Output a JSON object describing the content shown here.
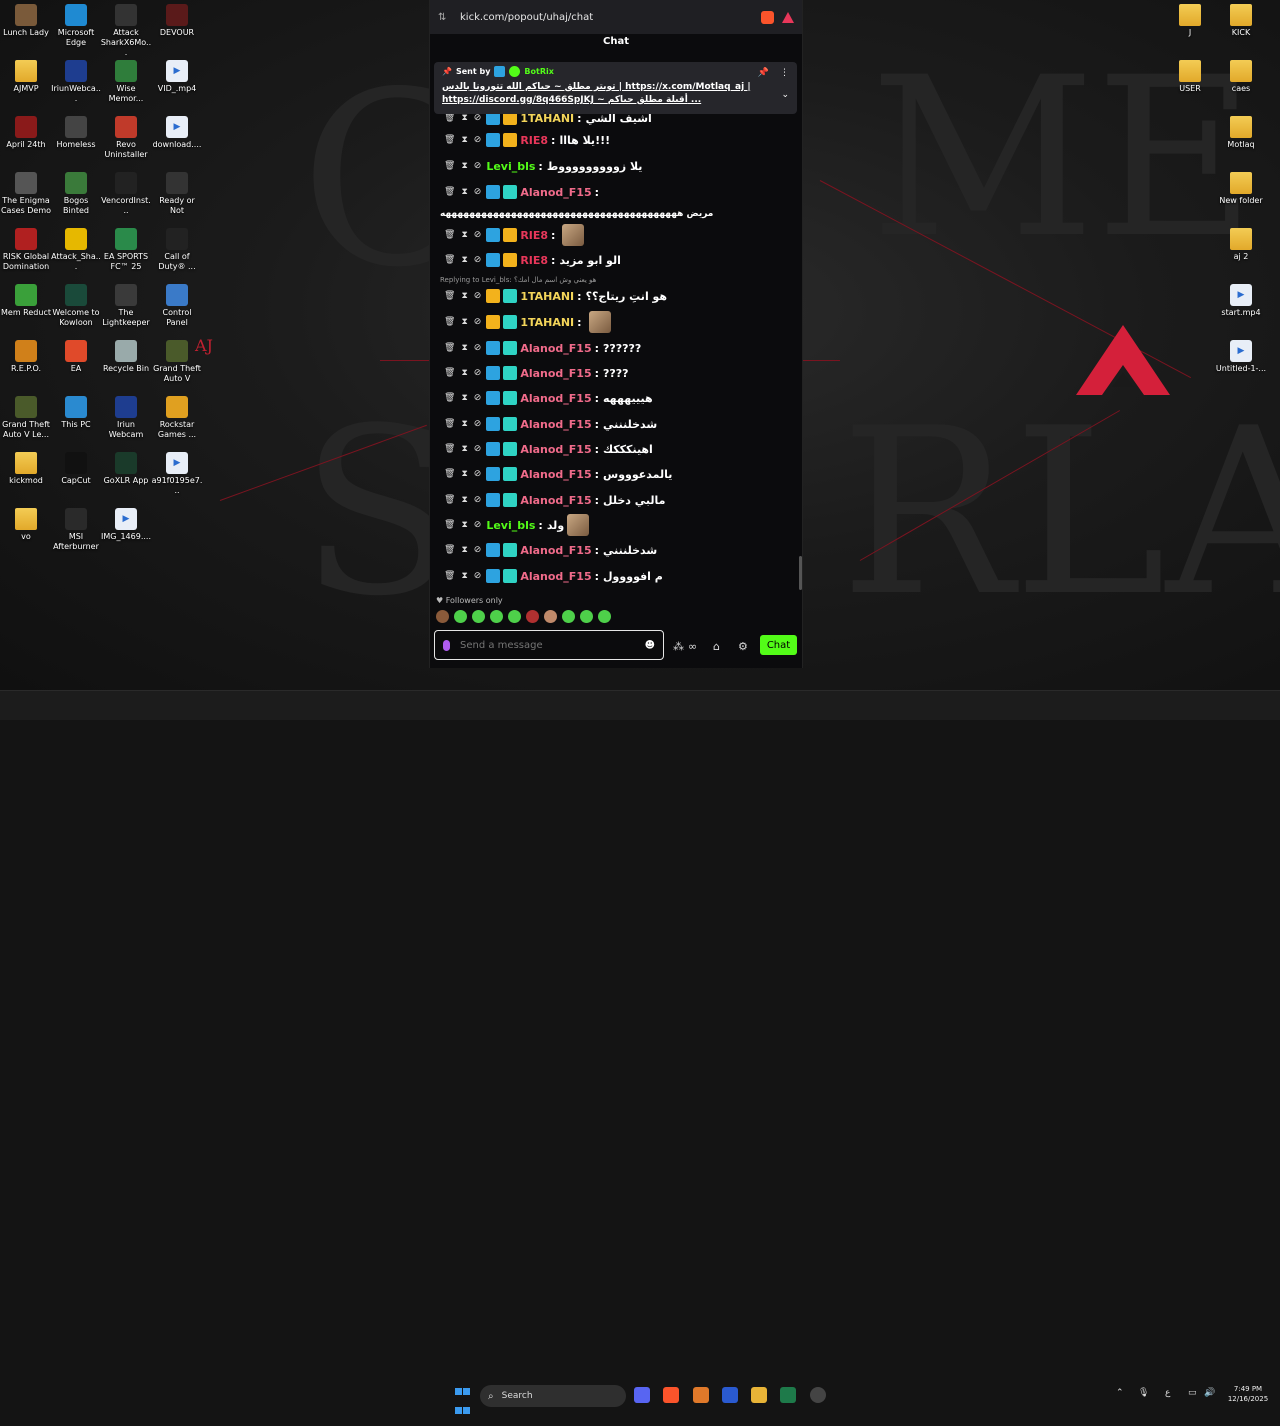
{
  "desktop": {
    "left_icons": [
      {
        "label": "Lunch Lady",
        "color": "#7a5a3a"
      },
      {
        "label": "Microsoft Edge",
        "color": "#1f8ad2"
      },
      {
        "label": "Attack SharkX6Mo...",
        "color": "#333"
      },
      {
        "label": "DEVOUR",
        "color": "#5a1a1a"
      },
      {
        "label": "AJMVP",
        "color": "folder"
      },
      {
        "label": "IriunWebca...",
        "color": "#1e3d8f"
      },
      {
        "label": "Wise Memor...",
        "color": "#2f7d3b"
      },
      {
        "label": "VID_.mp4",
        "color": "file"
      },
      {
        "label": "April 24th",
        "color": "#8a1a1a"
      },
      {
        "label": "Homeless",
        "color": "#444"
      },
      {
        "label": "Revo Uninstaller",
        "color": "#c03a2a"
      },
      {
        "label": "download....",
        "color": "file"
      },
      {
        "label": "The Enigma Cases Demo",
        "color": "#555"
      },
      {
        "label": "Bogos Binted",
        "color": "#3a7a3a"
      },
      {
        "label": "VencordInst...",
        "color": "#222"
      },
      {
        "label": "Ready or Not",
        "color": "#333"
      },
      {
        "label": "RISK Global Domination",
        "color": "#b02020"
      },
      {
        "label": "Attack_Sha...",
        "color": "#e6b800"
      },
      {
        "label": "EA SPORTS FC™ 25",
        "color": "#2a8a4a"
      },
      {
        "label": "Call of Duty® ...",
        "color": "#222"
      },
      {
        "label": "Mem Reduct",
        "color": "#3aa03a"
      },
      {
        "label": "Welcome to Kowloon",
        "color": "#1a4a3a"
      },
      {
        "label": "The Lightkeeper",
        "color": "#3a3a3a"
      },
      {
        "label": "Control Panel",
        "color": "#3a7ac8"
      },
      {
        "label": "R.E.P.O.",
        "color": "#d0801a"
      },
      {
        "label": "EA",
        "color": "#e04a2a"
      },
      {
        "label": "Recycle Bin",
        "color": "#9aa"
      },
      {
        "label": "Grand Theft Auto V",
        "color": "#4a5a2a"
      },
      {
        "label": "Grand Theft Auto V Le...",
        "color": "#4a5a2a"
      },
      {
        "label": "This PC",
        "color": "#2a8ad0"
      },
      {
        "label": "Iriun Webcam",
        "color": "#1e3d8f"
      },
      {
        "label": "Rockstar Games ...",
        "color": "#e0a020"
      },
      {
        "label": "kickmod",
        "color": "folder"
      },
      {
        "label": "CapCut",
        "color": "#111"
      },
      {
        "label": "GoXLR App",
        "color": "#1a3a2a"
      },
      {
        "label": "a91f0195e7...",
        "color": "file"
      },
      {
        "label": "vo",
        "color": "folder"
      },
      {
        "label": "MSI Afterburner",
        "color": "#2a2a2a"
      },
      {
        "label": "IMG_1469....",
        "color": "file"
      }
    ],
    "right_icons": [
      {
        "label": "J",
        "color": "folder"
      },
      {
        "label": "KICK",
        "color": "folder"
      },
      {
        "label": "USER",
        "color": "folder"
      },
      {
        "label": "caes",
        "color": "folder"
      },
      {
        "label": "Motlaq",
        "color": "folder"
      },
      {
        "label": "New folder",
        "color": "folder"
      },
      {
        "label": "aj 2",
        "color": "folder"
      },
      {
        "label": "start.mp4",
        "color": "file"
      },
      {
        "label": "Untitled-1-...",
        "color": "file"
      }
    ],
    "aj_mark": "AJ"
  },
  "browser": {
    "url": "kick.com/popout/uhaj/chat",
    "chat_title": "Chat"
  },
  "pinned": {
    "sent_by": "Sent by",
    "sender": "BotRix",
    "message": "تويتر مطلق ~ حياكم الله تتورونا بالدس | https://x.com/Motlaq_aj | https://discord.gg/8q466SpJKJ ~ أقيلة مطلق حياكم ..."
  },
  "messages": [
    {
      "user": "1TAHANI",
      "color": "#f3d55a",
      "text": "اشيف الشي",
      "badges": [
        "mod",
        "crown"
      ]
    },
    {
      "user": "RIE8",
      "color": "#e8375a",
      "text": "يلا هااا!!!",
      "badges": [
        "mod",
        "crown"
      ]
    },
    {
      "user": "Levi_bls",
      "color": "#53fc18",
      "text": "يلا زوووووووووط",
      "badges": []
    },
    {
      "user": "Alanod_F15",
      "color": "#f06b8a",
      "text": "",
      "badges": [
        "mod",
        "og"
      ]
    },
    {
      "user": "",
      "color": "#fff",
      "text": "مريض ههههههههههههههههههههههههههههههههههههههههه",
      "badges": []
    },
    {
      "user": "RIE8",
      "color": "#e8375a",
      "text": "",
      "badges": [
        "mod",
        "crown"
      ],
      "emote": true
    },
    {
      "user": "RIE8",
      "color": "#e8375a",
      "text": "الو ابو مزيد",
      "badges": [
        "mod",
        "crown"
      ]
    },
    {
      "user": "1TAHANI",
      "color": "#f3d55a",
      "text": "هو انتِ ريتاج؟؟",
      "badges": [
        "crown",
        "og"
      ]
    },
    {
      "user": "1TAHANI",
      "color": "#f3d55a",
      "text": "",
      "badges": [
        "crown",
        "og"
      ],
      "emote": true
    },
    {
      "user": "Alanod_F15",
      "color": "#f06b8a",
      "text": "??????",
      "badges": [
        "mod",
        "og"
      ]
    },
    {
      "user": "Alanod_F15",
      "color": "#f06b8a",
      "text": "????",
      "badges": [
        "mod",
        "og"
      ]
    },
    {
      "user": "Alanod_F15",
      "color": "#f06b8a",
      "text": "هيييهههه",
      "badges": [
        "mod",
        "og"
      ]
    },
    {
      "user": "Alanod_F15",
      "color": "#f06b8a",
      "text": "شدخلننني",
      "badges": [
        "mod",
        "og"
      ]
    },
    {
      "user": "Alanod_F15",
      "color": "#f06b8a",
      "text": "اهينكككك",
      "badges": [
        "mod",
        "og"
      ]
    },
    {
      "user": "Alanod_F15",
      "color": "#f06b8a",
      "text": "يالمدعوووس",
      "badges": [
        "mod",
        "og"
      ]
    },
    {
      "user": "Alanod_F15",
      "color": "#f06b8a",
      "text": "مالبي دخلل",
      "badges": [
        "mod",
        "og"
      ]
    },
    {
      "user": "Levi_bls",
      "color": "#53fc18",
      "text": "ولد",
      "badges": [],
      "emote": true
    },
    {
      "user": "Alanod_F15",
      "color": "#f06b8a",
      "text": "شدخلننني",
      "badges": [
        "mod",
        "og"
      ]
    },
    {
      "user": "Alanod_F15",
      "color": "#f06b8a",
      "text": "م افوووول",
      "badges": [
        "mod",
        "og"
      ]
    }
  ],
  "reply": "Replying to Levi_bls: هو يعني وش اسم مال امك؟",
  "followers_only": "Followers only",
  "input": {
    "placeholder": "Send a message"
  },
  "chat_button": "Chat",
  "taskbar": {
    "search": "Search",
    "time": "7:49 PM",
    "date": "12/16/2025",
    "lang": "ع"
  }
}
